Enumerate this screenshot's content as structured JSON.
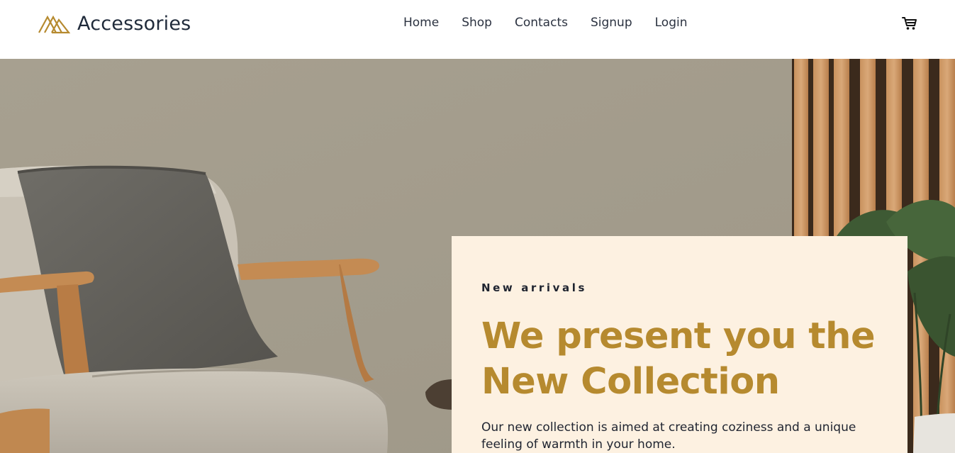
{
  "brand": {
    "name": "Accessories",
    "accent_color": "#b68a2f",
    "logo_icon": "mountain-logo-icon"
  },
  "nav": {
    "items": [
      {
        "label": "Home"
      },
      {
        "label": "Shop"
      },
      {
        "label": "Contacts"
      },
      {
        "label": "Signup"
      },
      {
        "label": "Login"
      }
    ],
    "cart_icon": "cart-icon"
  },
  "hero": {
    "eyebrow": "New arrivals",
    "headline": "We present you the New Collection",
    "description": "Our new collection is aimed at creating coziness and a unique feeling of warmth in your home.",
    "card_background": "#fdf1e1",
    "wall_color": "#a39c8c"
  }
}
